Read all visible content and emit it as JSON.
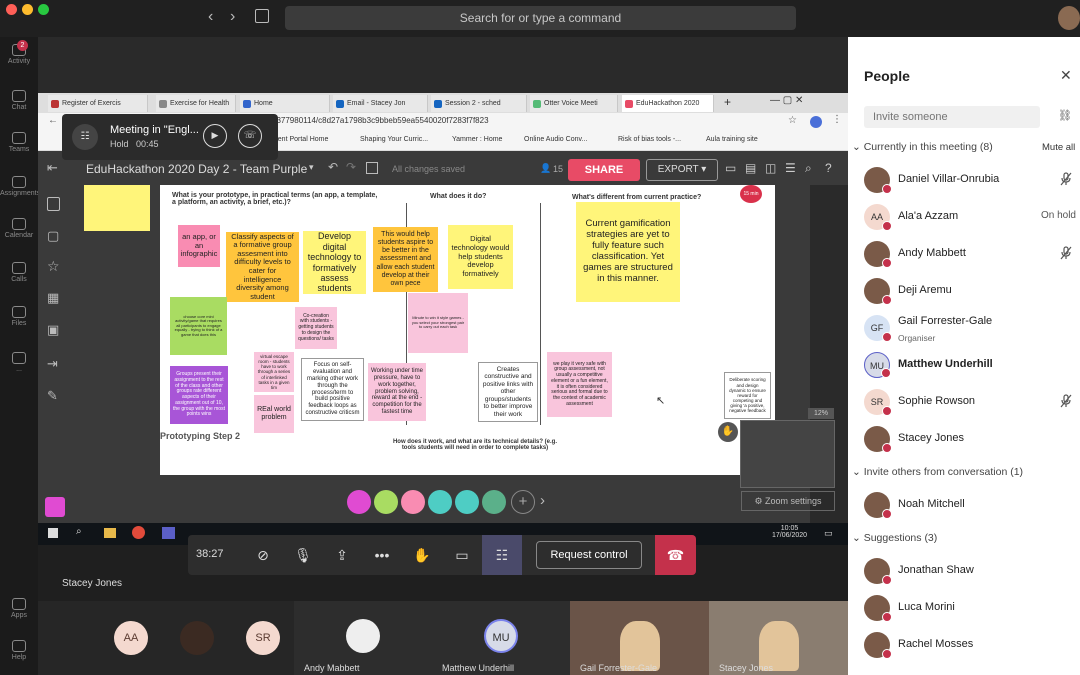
{
  "colors": {
    "accent": "#e84b66",
    "hangup": "#c4314b",
    "panel_bg": "#ffffff",
    "rail_bg": "#1b1b1b"
  },
  "titlebar": {
    "search_placeholder": "Search for or type a command"
  },
  "rail": {
    "items": [
      {
        "label": "Activity",
        "icon": "bell-icon"
      },
      {
        "label": "Chat",
        "icon": "chat-icon"
      },
      {
        "label": "Teams",
        "icon": "teams-icon"
      },
      {
        "label": "Assignments",
        "icon": "assignments-icon"
      },
      {
        "label": "Calendar",
        "icon": "calendar-icon"
      },
      {
        "label": "Calls",
        "icon": "phone-icon"
      },
      {
        "label": "Files",
        "icon": "file-icon"
      },
      {
        "label": "...",
        "icon": "more-icon"
      },
      {
        "label": "Apps",
        "icon": "apps-icon"
      },
      {
        "label": "Help",
        "icon": "help-icon"
      }
    ],
    "activity_badge": "2"
  },
  "browser": {
    "tabs": [
      "Register of Exercis",
      "Exercise for Health",
      "Home",
      "Email - Stacey Jon",
      "Session 2 - sched",
      "Otter Voice Meeti",
      "EduHackathon 2020"
    ],
    "url": "2377980114/c8d27a1798b3c9bbeb59ea5540020f7283f7f823",
    "bookmarks": [
      "udent Portal Home",
      "Shaping Your Curric...",
      "Yammer : Home",
      "Online Audio Conv...",
      "Risk of bias tools -...",
      "Aula training site"
    ]
  },
  "app": {
    "doc_title": "EduHackathon 2020 Day 2 - Team Purple",
    "saved": "All changes saved",
    "viewers": "15",
    "share_label": "SHARE",
    "export_label": "EXPORT",
    "zoom": "12%",
    "zoom_settings": "Zoom settings",
    "timer_badge": "15 min"
  },
  "board": {
    "col1_header": "What is your prototype, in practical terms (an app, a template, a platform, an activity, a brief, etc.)?",
    "col2_header": "What does it do?",
    "col3_header": "What's different from current practice?",
    "step_label": "Prototyping Step 2",
    "bottom_header": "How does it work, and what are its technical details? (e.g. tools students will need in order to complete tasks)",
    "notes": {
      "app": "an app, or an infographic",
      "classify": "Classify aspects of a formative group assesment into difficulty levels to cater for intelligence diversity among student",
      "develop": "Develop digital technology to formatively assess students",
      "aspire": "This would help students aspire to be better in the assessment and allow each student develop at their own pece",
      "digital": "Digital technology would help students develop formatively",
      "gamification": "Current gamification strategies are yet to fully feature such classification. Yet games are structured in this manner.",
      "choose": "choose core mini activity/game that requires all participants to engage equally - trying to think of a game that does this",
      "cocreation": "Co-creation with students - getting students to design the questions/ tasks",
      "minute": "Minute to win it style games - you select your strongest pair to carry out each task",
      "groups": "Groups present their assignment to the rest of the class and other groups rate different aspects of their assignment out of 10, the group with the most points wins",
      "escape": "virtual escape room - students have to work through a series of interlinked tasks in a given tim",
      "realworld": "REal world problem",
      "selfeval": "Focus on self-evaluation and marking other work through the process/term to build positive feedback loops as constructive criticsm",
      "pressure": "Working under time pressure, have to work together, problem solving, reward at the end - competition for the fastest time",
      "constructive": "Creates constructive and positive links with other groups/students to better improve their work",
      "safe": "we play it very safe with group assessment, not usually a competitive element or a fun element, it is often considered serious and formal due to the context of academic assessment",
      "deliberate": "Deliberate scoring and design dynamic to ensure reward for competing and giving 'a positive, negative feedback"
    }
  },
  "meeting": {
    "title": "Meeting in \"Engl...",
    "status": "Hold",
    "time": "00:45"
  },
  "taskbar": {
    "time": "10:05",
    "date": "17/06/2020"
  },
  "controls": {
    "timer": "38:27",
    "request_control": "Request control",
    "presenter": "Stacey Jones"
  },
  "strip": {
    "tiles": [
      {
        "initials": "AA",
        "name": ""
      },
      {
        "initials": "",
        "name": ""
      },
      {
        "initials": "SR",
        "name": ""
      },
      {
        "initials": "",
        "name": "Andy Mabbett"
      },
      {
        "initials": "MU",
        "name": "Matthew Underhill"
      },
      {
        "initials": "",
        "name": "Gail Forrester-Gale"
      },
      {
        "initials": "",
        "name": "Stacey Jones"
      }
    ]
  },
  "people": {
    "title": "People",
    "invite_placeholder": "Invite someone",
    "in_meeting_label": "Currently in this meeting",
    "in_meeting_count": "(8)",
    "mute_all": "Mute all",
    "members": [
      {
        "name": "Daniel Villar-Onrubia",
        "initials": "",
        "right": "",
        "muted": true,
        "sub": ""
      },
      {
        "name": "Ala'a Azzam",
        "initials": "AA",
        "right": "On hold",
        "muted": false,
        "sub": ""
      },
      {
        "name": "Andy Mabbett",
        "initials": "",
        "right": "",
        "muted": true,
        "sub": ""
      },
      {
        "name": "Deji Aremu",
        "initials": "",
        "right": "",
        "muted": false,
        "sub": ""
      },
      {
        "name": "Gail Forrester-Gale",
        "initials": "GF",
        "right": "",
        "muted": false,
        "sub": "Organiser"
      },
      {
        "name": "Matthew Underhill",
        "initials": "MU",
        "right": "",
        "muted": false,
        "sub": ""
      },
      {
        "name": "Sophie Rowson",
        "initials": "SR",
        "right": "",
        "muted": true,
        "sub": ""
      },
      {
        "name": "Stacey Jones",
        "initials": "",
        "right": "",
        "muted": false,
        "sub": ""
      }
    ],
    "invite_others_label": "Invite others from conversation",
    "invite_others_count": "(1)",
    "invite_others": [
      {
        "name": "Noah Mitchell"
      }
    ],
    "suggestions_label": "Suggestions",
    "suggestions_count": "(3)",
    "suggestions": [
      {
        "name": "Jonathan Shaw"
      },
      {
        "name": "Luca Morini"
      },
      {
        "name": "Rachel Mosses"
      }
    ]
  }
}
